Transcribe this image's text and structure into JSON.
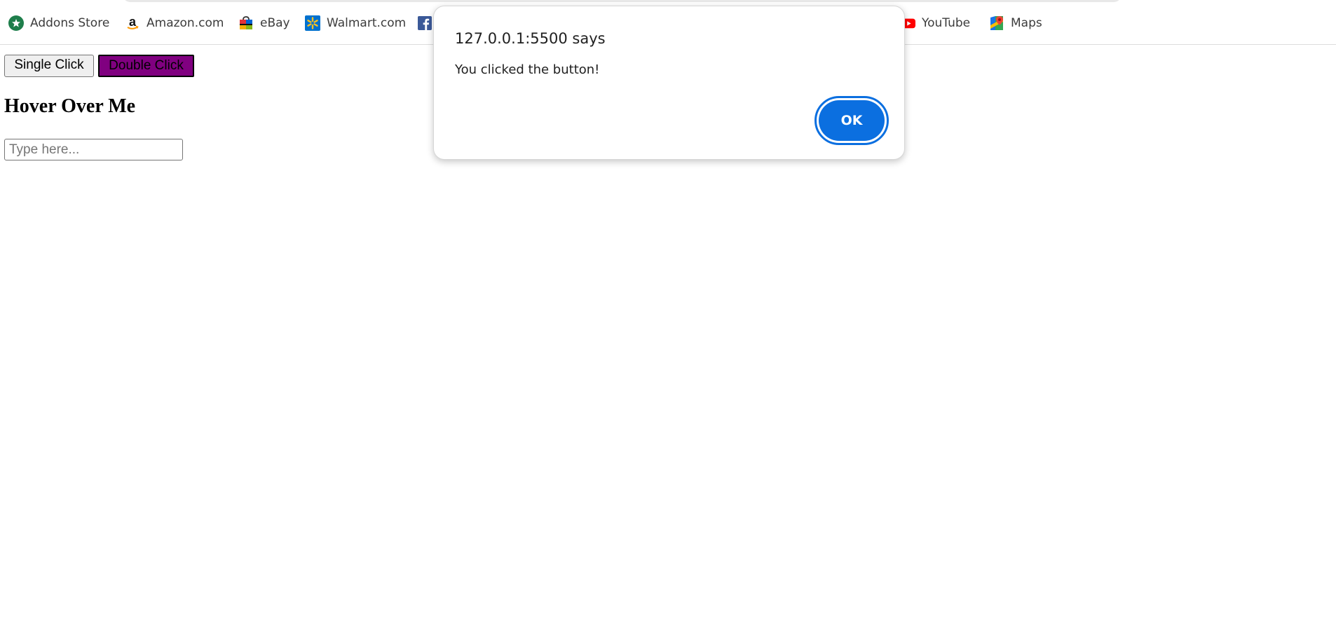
{
  "bookmarks": [
    {
      "label": "Addons Store",
      "icon": "addons-store-icon"
    },
    {
      "label": "Amazon.com",
      "icon": "amazon-icon"
    },
    {
      "label": "eBay",
      "icon": "ebay-icon"
    },
    {
      "label": "Walmart.com",
      "icon": "walmart-icon"
    },
    {
      "label": "",
      "icon": "facebook-icon"
    },
    {
      "label": "YouTube",
      "icon": "youtube-icon"
    },
    {
      "label": "Maps",
      "icon": "maps-icon"
    }
  ],
  "page": {
    "single_click_label": "Single Click",
    "double_click_label": "Double Click",
    "hover_heading": "Hover Over Me",
    "input_placeholder": "Type here...",
    "input_value": ""
  },
  "dialog": {
    "title": "127.0.0.1:5500 says",
    "message": "You clicked the button!",
    "ok_label": "OK"
  },
  "colors": {
    "double_click_bg": "#800080",
    "ok_button_bg": "#0b6fe0"
  }
}
